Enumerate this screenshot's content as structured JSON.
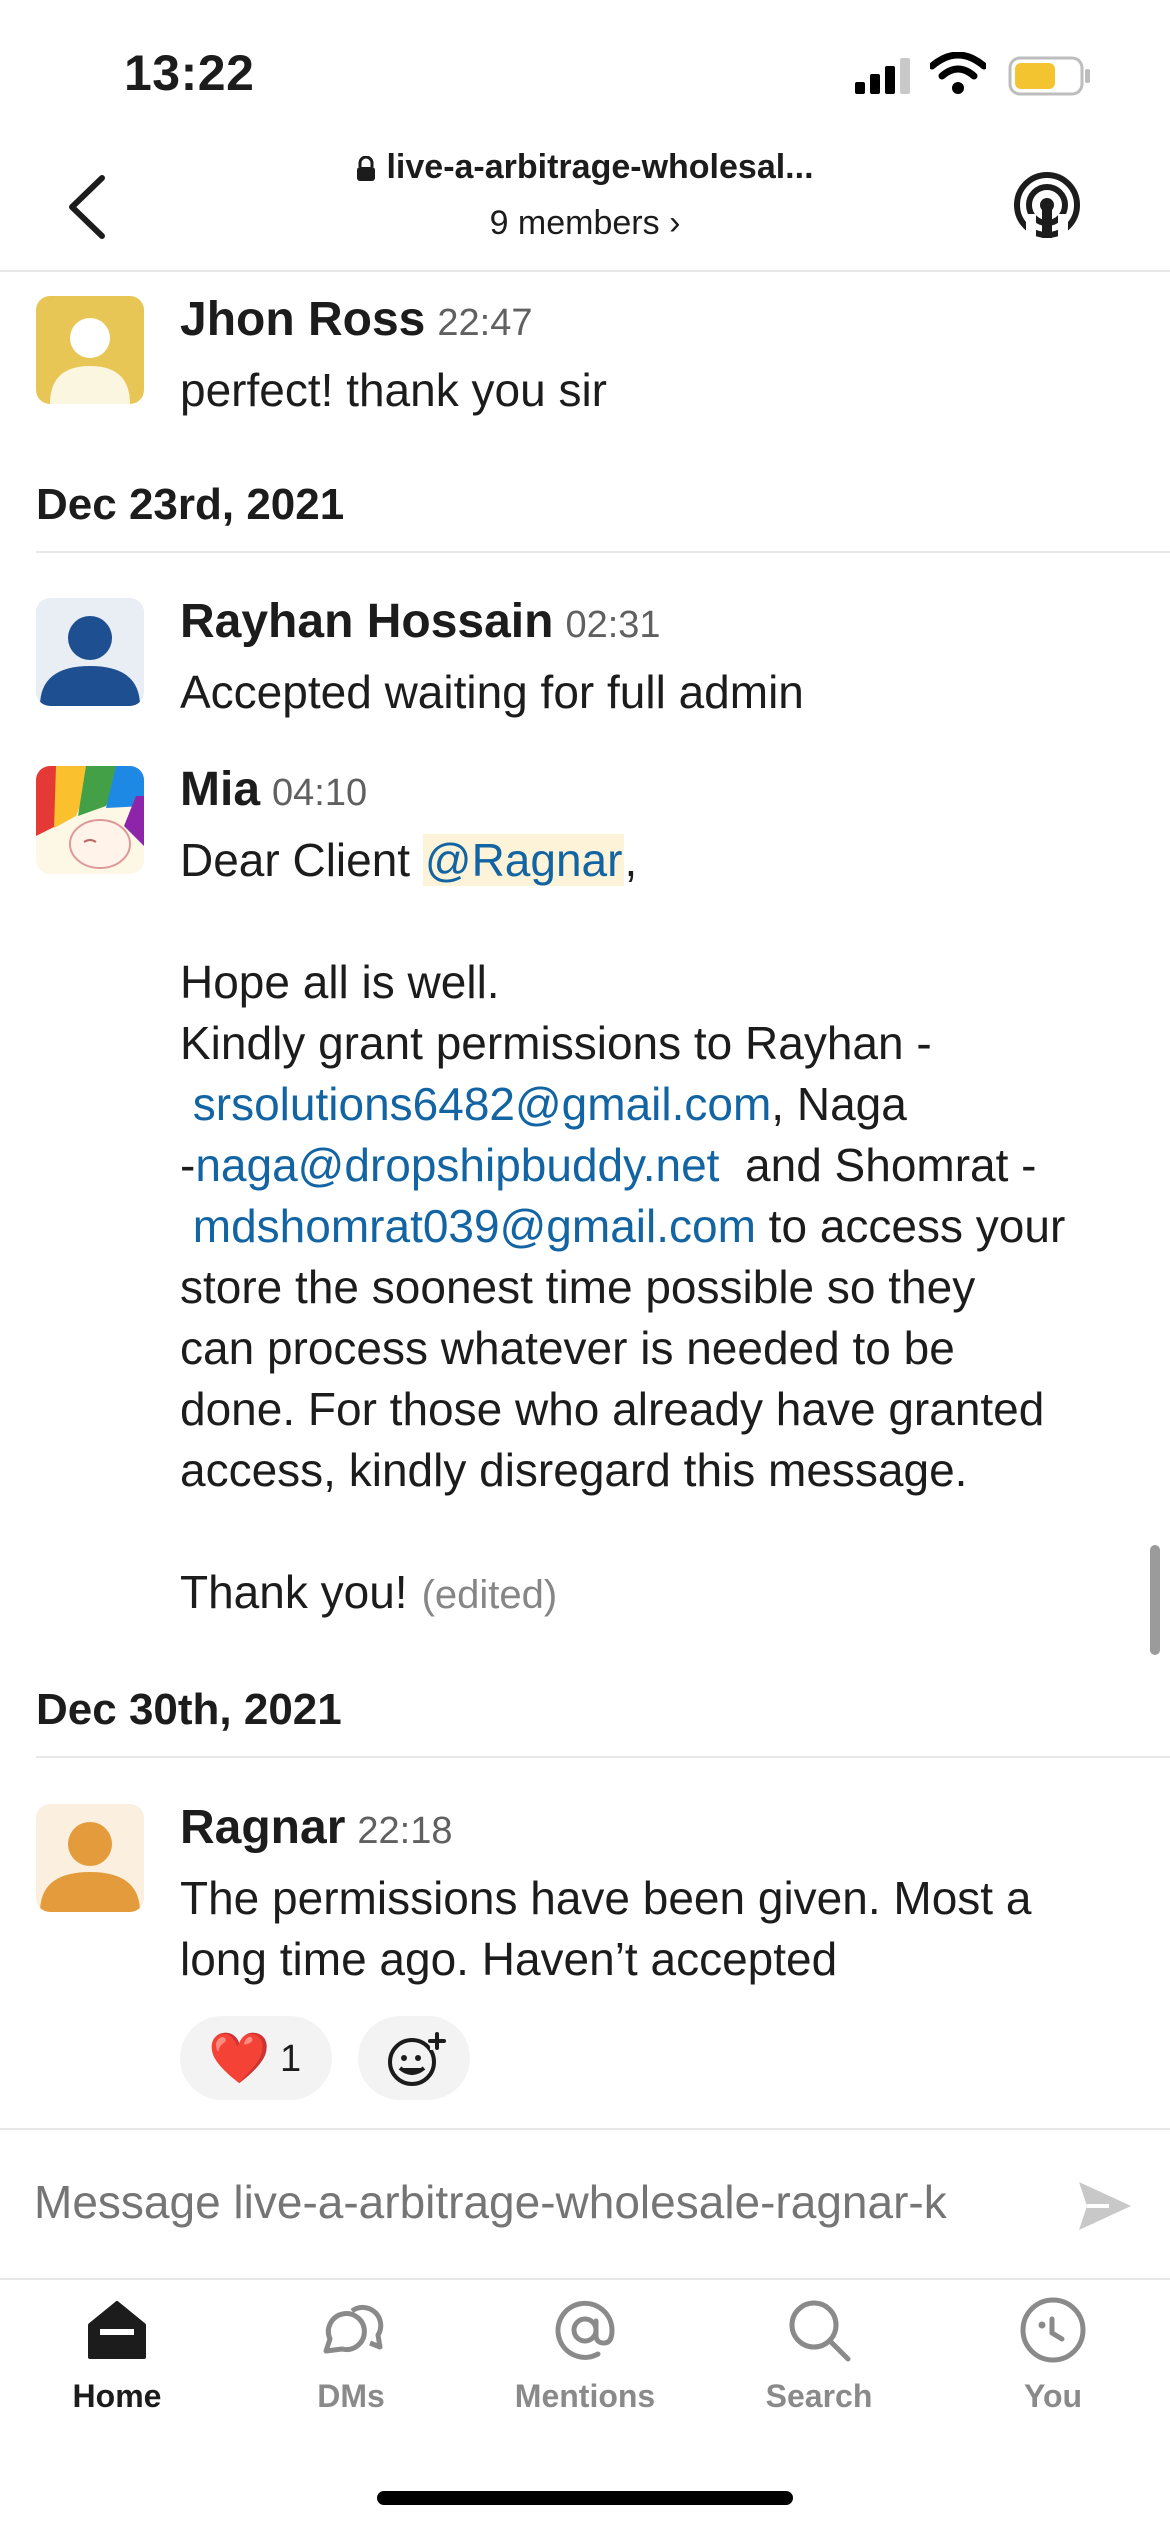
{
  "status_bar": {
    "time": "13:22"
  },
  "header": {
    "channel_name": "live-a-arbitrage-wholesal...",
    "members": "9 members ›"
  },
  "messages": [
    {
      "author": "Jhon Ross",
      "time": "22:47",
      "text": "perfect! thank you sir",
      "avatar_color": "#e8c656"
    },
    {
      "date_separator": "Dec 23rd, 2021"
    },
    {
      "author": "Rayhan Hossain",
      "time": "02:31",
      "text": "Accepted waiting for full admin",
      "avatar_color": "#1e4f91"
    },
    {
      "author": "Mia",
      "time": "04:10",
      "greeting": "Dear Client ",
      "mention": "@Ragnar",
      "greeting_end": ",",
      "line2": "Hope all is well.",
      "line3": "Kindly grant permissions to Rayhan -",
      "email1": "srsolutions6482@gmail.com",
      "after_email1": ", Naga",
      "dash": "-",
      "email2": "naga@dropshipbuddy.net",
      "after_email2": "  and Shomrat -",
      "email3": "mdshomrat039@gmail.com",
      "after_email3": " to access your",
      "line7": "store the soonest time possible so they",
      "line8": "can process whatever is needed to be",
      "line9": "done. For those who already have granted",
      "line10": "access, kindly disregard this message.",
      "closing": "Thank you!",
      "edited": "(edited)"
    },
    {
      "date_separator": "Dec 30th, 2021"
    },
    {
      "author": "Ragnar",
      "time": "22:18",
      "line1": "The permissions have been given. Most a",
      "line2": "long time ago. Haven’t accepted",
      "avatar_color": "#e39b3b",
      "reaction": {
        "emoji": "❤️",
        "count": "1"
      }
    }
  ],
  "composer": {
    "placeholder": "Message live-a-arbitrage-wholesale-ragnar-k"
  },
  "tabs": [
    {
      "label": "Home",
      "icon": "home-icon",
      "active": true
    },
    {
      "label": "DMs",
      "icon": "dms-icon"
    },
    {
      "label": "Mentions",
      "icon": "mentions-icon"
    },
    {
      "label": "Search",
      "icon": "search-icon"
    },
    {
      "label": "You",
      "icon": "you-icon"
    }
  ],
  "colors": {
    "link": "#1264a3",
    "mention_bg": "#fdf3d8",
    "battery": "#f4c430"
  }
}
